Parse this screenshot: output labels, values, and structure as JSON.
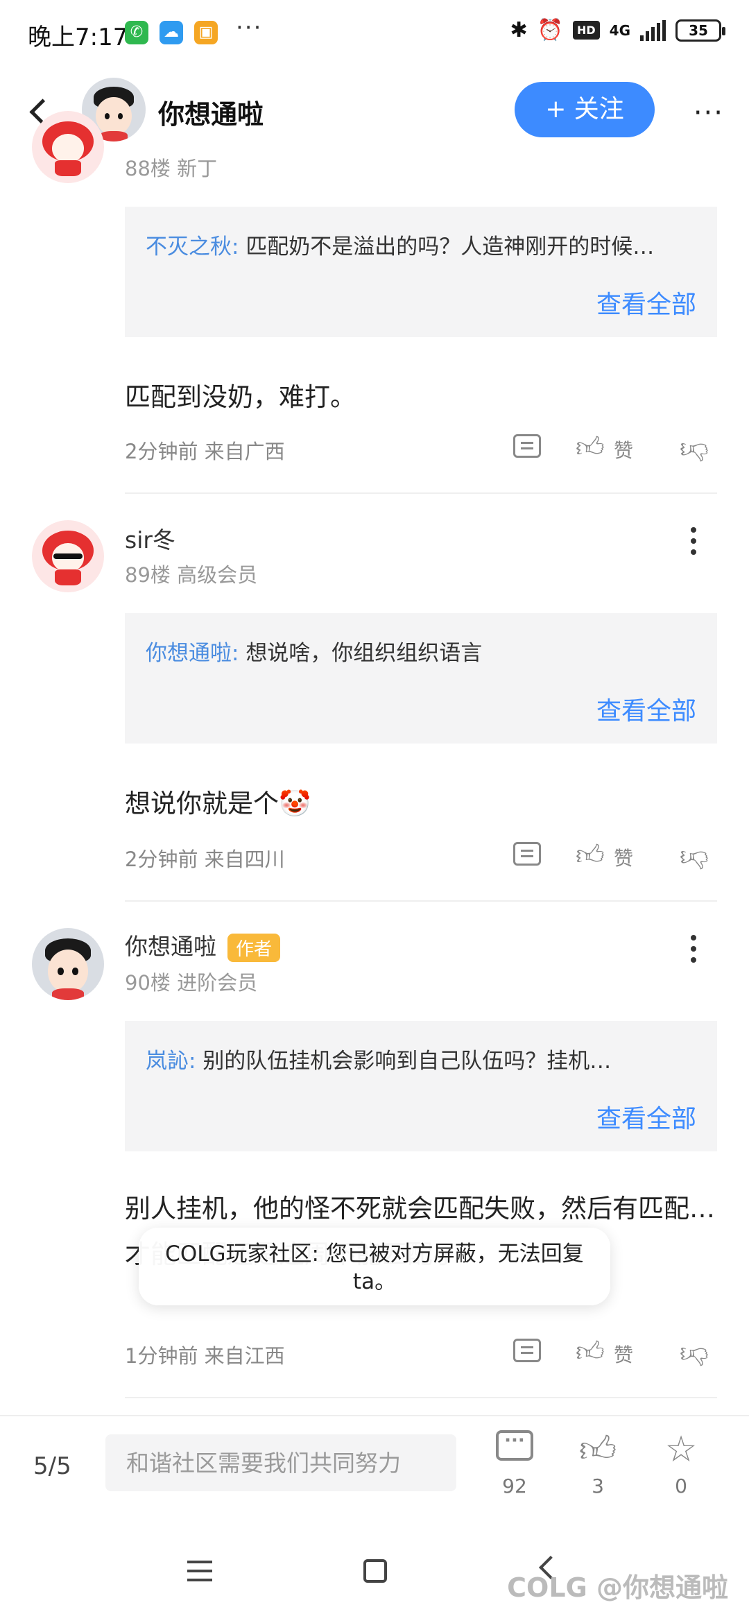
{
  "status_bar": {
    "time": "晚上7:17",
    "dots": "···",
    "network": "4G",
    "hd": "HD",
    "battery": "35"
  },
  "header": {
    "title": "你想通啦",
    "follow_label": "+ 关注",
    "more": "···"
  },
  "posts": [
    {
      "username": "",
      "floor": "88楼 新丁",
      "quote_user": "不灭之秋:",
      "quote_text": "匹配奶不是溢出的吗？人造神刚开的时候…",
      "quote_more": "查看全部",
      "content": "匹配到没奶，难打。",
      "meta": "2分钟前 来自广西",
      "like_label": "赞"
    },
    {
      "username": "sir冬",
      "floor": "89楼 高级会员",
      "quote_user": "你想通啦:",
      "quote_text": "想说啥，你组织组织语言",
      "quote_more": "查看全部",
      "content": "想说你就是个🤡",
      "meta": "2分钟前 来自四川",
      "like_label": "赞"
    },
    {
      "username": "你想通啦",
      "badge": "作者",
      "floor": "90楼 进阶会员",
      "quote_user": "岚訫:",
      "quote_text": "别的队伍挂机会影响到自己队伍吗？挂机…",
      "quote_more": "查看全部",
      "content": "别人挂机，他的怪不死就会匹配失败，然后有匹配…才能匹配还是这周不能匹配了",
      "meta": "1分钟前 来自江西",
      "like_label": "赞"
    }
  ],
  "toast": {
    "text": "COLG玩家社区: 您已被对方屏蔽，无法回复ta。"
  },
  "bottom_bar": {
    "page": "5/5",
    "input_placeholder": "和谐社区需要我们共同努力",
    "comments_count": "92",
    "likes_count": "3",
    "favorites_count": "0"
  },
  "watermark": "COLG @你想通啦"
}
